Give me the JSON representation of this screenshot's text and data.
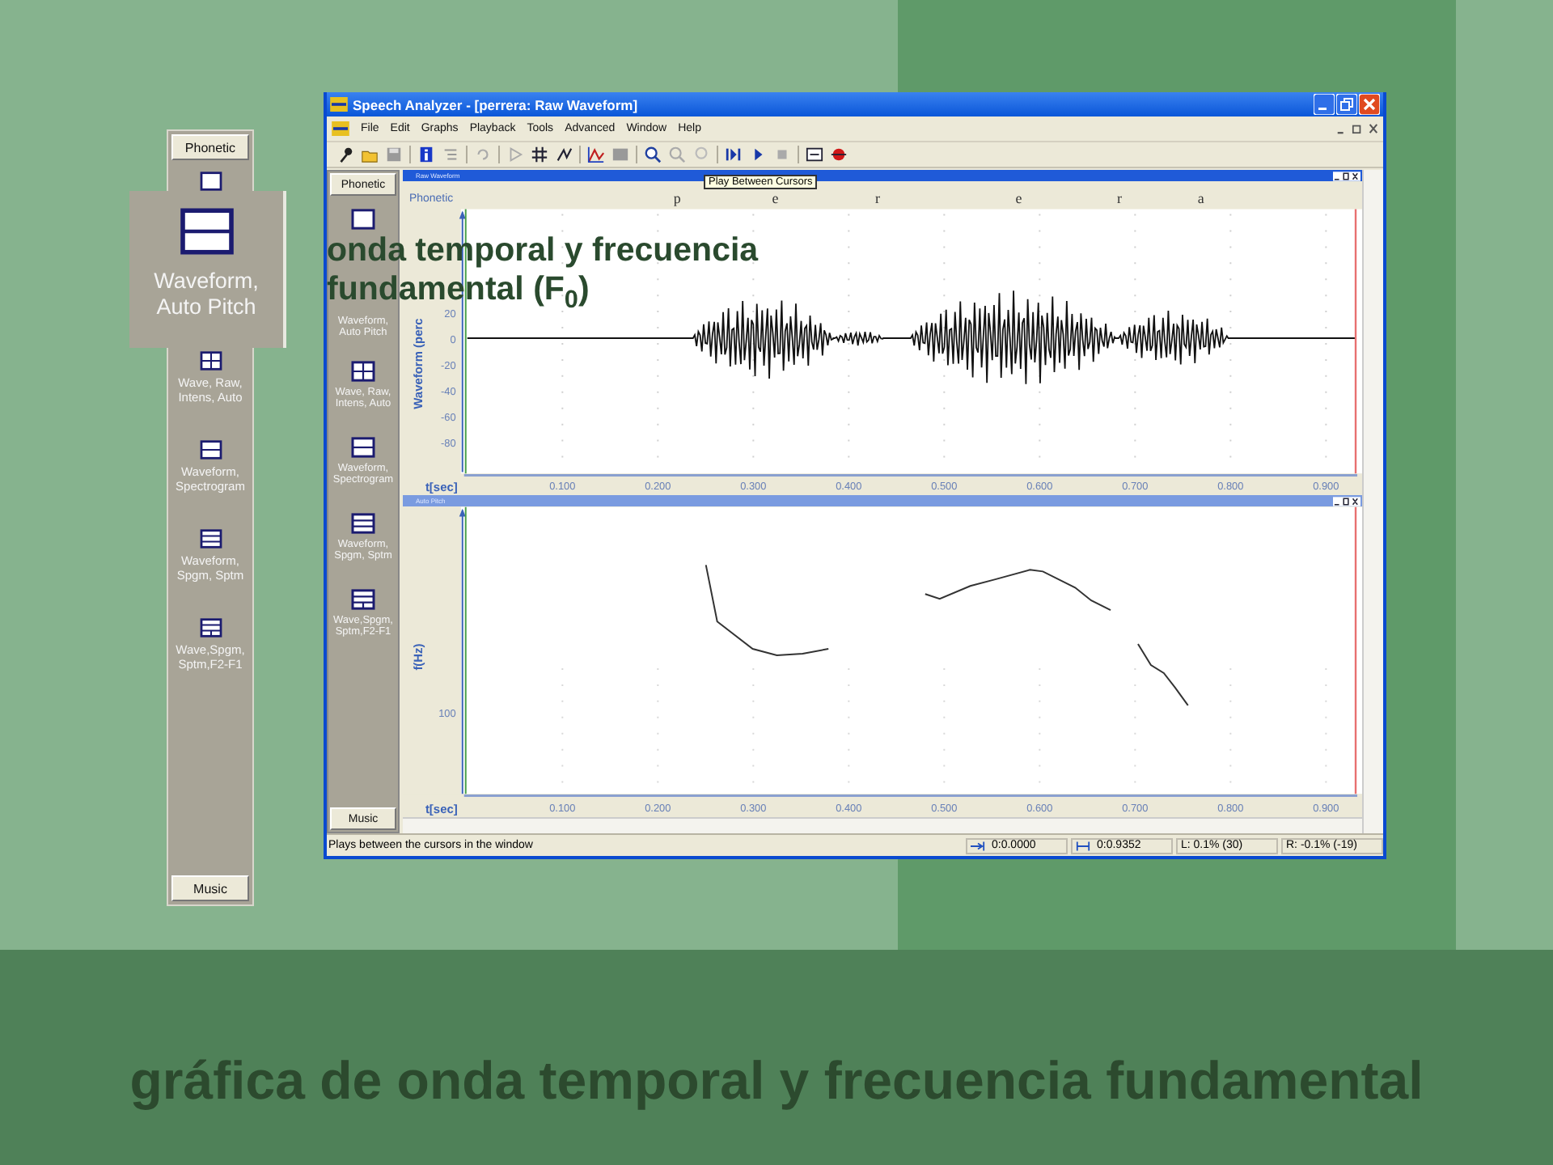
{
  "left_panel": {
    "top_button": "Phonetic",
    "items": [
      {
        "kind": "single"
      },
      {
        "kind": "grid4",
        "label": "Wave, Raw, Intens, Auto"
      },
      {
        "kind": "split2",
        "label": "Waveform, Spectrogram"
      },
      {
        "kind": "split3",
        "label": "Waveform, Spgm, Sptm"
      },
      {
        "kind": "split3b",
        "label": "Wave,Spgm, Sptm,F2-F1"
      }
    ],
    "bottom_button": "Music"
  },
  "magnified_item": {
    "kind": "split2",
    "label": "Waveform, Auto Pitch"
  },
  "window": {
    "title": "Speech Analyzer - [perrera: Raw Waveform]",
    "menu": [
      "File",
      "Edit",
      "Graphs",
      "Playback",
      "Tools",
      "Advanced",
      "Window",
      "Help"
    ],
    "tooltip": "Play Between Cursors",
    "sidebar": {
      "top_button": "Phonetic",
      "items": [
        {
          "kind": "single"
        },
        {
          "label": "Waveform, Auto Pitch"
        },
        {
          "kind": "grid4",
          "label": "Wave, Raw, Intens, Auto"
        },
        {
          "kind": "split2",
          "label": "Waveform, Spectrogram"
        },
        {
          "kind": "split3",
          "label": "Waveform, Spgm, Sptm"
        },
        {
          "kind": "split3b",
          "label": "Wave,Spgm, Sptm,F2-F1"
        }
      ],
      "bottom_button": "Music"
    },
    "panes": [
      {
        "kind": "waveform",
        "caption": "Raw Waveform",
        "tier_label": "Phonetic",
        "segments": [
          "p",
          "e",
          "r",
          "e",
          "r",
          "a"
        ],
        "ylabel": "Waveform (perc",
        "yticks": [
          "20",
          "0",
          "-20",
          "-40",
          "-60",
          "-80"
        ],
        "xlabel": "t[sec]",
        "xticks": [
          "0.100",
          "0.200",
          "0.300",
          "0.400",
          "0.500",
          "0.600",
          "0.700",
          "0.800",
          "0.900"
        ]
      },
      {
        "kind": "pitch",
        "caption": "Auto Pitch",
        "ylabel": "f(Hz)",
        "yticks": [
          "100"
        ],
        "xlabel": "t[sec]",
        "xticks": [
          "0.100",
          "0.200",
          "0.300",
          "0.400",
          "0.500",
          "0.600",
          "0.700",
          "0.800",
          "0.900"
        ]
      }
    ],
    "status_bar": {
      "message": "Plays between the cursors in the window",
      "start": "0:0.0000",
      "length": "0:0.9352",
      "left": "L: 0.1% (30)",
      "right": "R: -0.1% (-19)"
    }
  },
  "overlay_caption": "onda temporal y frecuencia fundamental (F$_{0}$)",
  "slide_title": "gráfica de onda temporal y frecuencia fundamental"
}
